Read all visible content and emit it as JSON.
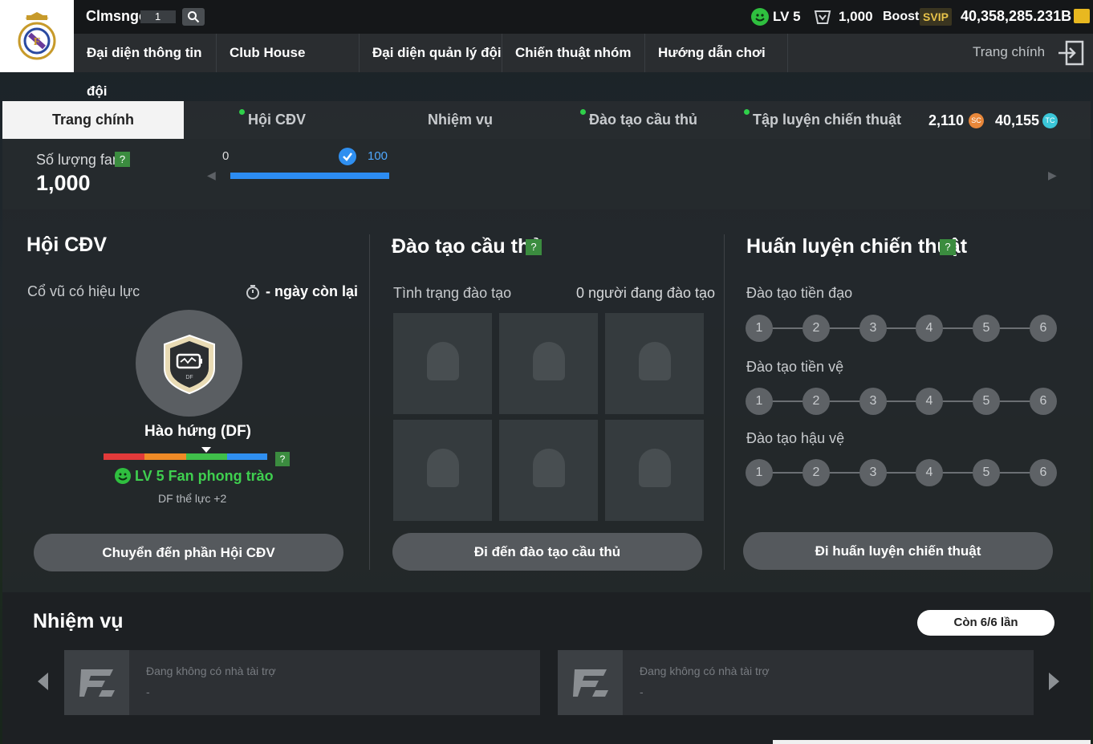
{
  "header": {
    "club_name": "Clmsnge",
    "club_level": "1",
    "lv_text": "LV 5",
    "fans": "1,000",
    "boost_label": "Boost",
    "svip_label": "SVIP",
    "currency": "40,358,285.231B",
    "icons": {
      "search": "search-icon",
      "level": "smile-icon",
      "fans": "fan-icon",
      "coins": "coins-icon"
    }
  },
  "nav": {
    "items": [
      {
        "label": "Đại diện thông tin đội"
      },
      {
        "label": "Club House"
      },
      {
        "label": "Đại diện quản lý đội"
      },
      {
        "label": "Chiến thuật nhóm"
      },
      {
        "label": "Hướng dẫn chơi"
      }
    ],
    "home": "Trang chính"
  },
  "tabs": {
    "items": [
      {
        "label": "Trang chính",
        "active": true
      },
      {
        "label": "Hội CĐV",
        "dot": true
      },
      {
        "label": "Nhiệm vụ"
      },
      {
        "label": "Đào tạo cầu thủ",
        "dot": true
      },
      {
        "label": "Tập luyện chiến thuật",
        "dot": true
      }
    ],
    "sc_value": "2,110",
    "sc_label": "SC",
    "tc_value": "40,155",
    "tc_label": "TC"
  },
  "fan_strip": {
    "label": "Số lượng fan",
    "help": "?",
    "value": "1,000",
    "progress_min": "0",
    "progress_max": "100",
    "progress_fraction": 1.0
  },
  "supporters": {
    "title": "Hội CĐV",
    "effect_label": "Cổ vũ có hiệu lực",
    "days_left": "- ngày còn lại",
    "emblem_name": "Hào hứng (DF)",
    "emblem_tag": "DF",
    "help": "?",
    "level_text": "LV 5 Fan phong trào",
    "bonus": "DF thể lực +2",
    "button": "Chuyển đến phần Hội CĐV",
    "bar_colors": [
      "#e23a3a",
      "#ef8a26",
      "#3fbf4a",
      "#2f8ff0"
    ]
  },
  "training": {
    "title": "Đào tạo cầu thủ",
    "help": "?",
    "status_label": "Tình trạng đào tạo",
    "count_label": "0 người đang đào tạo",
    "button": "Đi đến đào tạo cầu thủ"
  },
  "tactics": {
    "title": "Huấn luyện chiến thuật",
    "help": "?",
    "rows": [
      {
        "label": "Đào tạo tiền đạo",
        "steps": [
          "1",
          "2",
          "3",
          "4",
          "5",
          "6"
        ]
      },
      {
        "label": "Đào tạo tiền vệ",
        "steps": [
          "1",
          "2",
          "3",
          "4",
          "5",
          "6"
        ]
      },
      {
        "label": "Đào tạo hậu vệ",
        "steps": [
          "1",
          "2",
          "3",
          "4",
          "5",
          "6"
        ]
      }
    ],
    "button": "Đi huấn luyện chiến thuật"
  },
  "missions": {
    "title": "Nhiệm vụ",
    "remaining": "Còn 6/6 lần",
    "cards": [
      {
        "text": "Đang không có nhà tài trợ",
        "sub": "-"
      },
      {
        "text": "Đang không có nhà tài trợ",
        "sub": "-"
      }
    ]
  }
}
